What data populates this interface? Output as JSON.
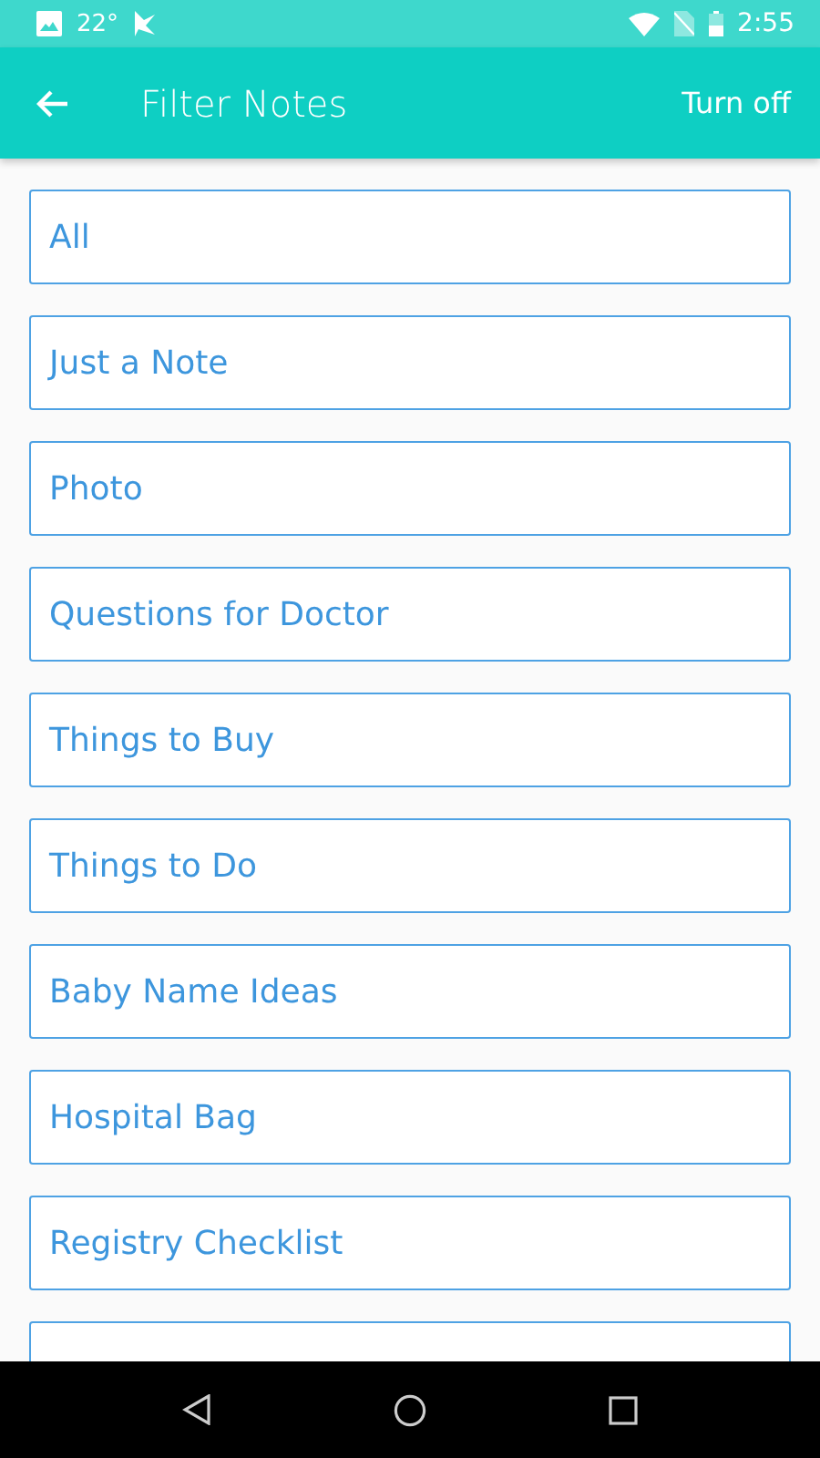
{
  "status_bar": {
    "temperature": "22°",
    "time": "2:55"
  },
  "toolbar": {
    "title": "Filter Notes",
    "action": "Turn off"
  },
  "filters": [
    {
      "kind": "option",
      "label": "All"
    },
    {
      "kind": "option",
      "label": "Just a Note"
    },
    {
      "kind": "option",
      "label": "Photo"
    },
    {
      "kind": "option",
      "label": "Questions for Doctor"
    },
    {
      "kind": "option",
      "label": "Things to Buy"
    },
    {
      "kind": "option",
      "label": "Things to Do"
    },
    {
      "kind": "option",
      "label": "Baby Name Ideas"
    },
    {
      "kind": "option",
      "label": "Hospital Bag"
    },
    {
      "kind": "option",
      "label": "Registry Checklist"
    },
    {
      "kind": "cut-off"
    }
  ]
}
